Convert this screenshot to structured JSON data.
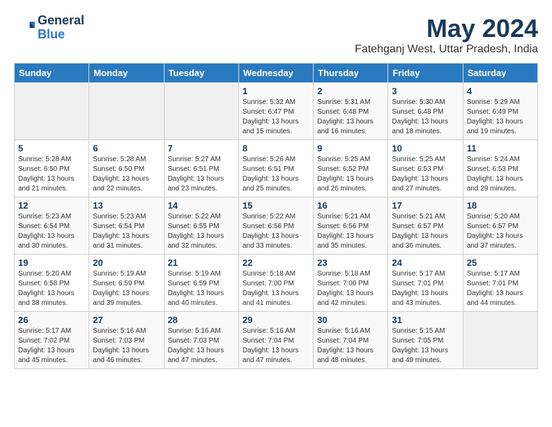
{
  "logo": {
    "line1": "General",
    "line2": "Blue"
  },
  "title": "May 2024",
  "subtitle": "Fatehganj West, Uttar Pradesh, India",
  "days_of_week": [
    "Sunday",
    "Monday",
    "Tuesday",
    "Wednesday",
    "Thursday",
    "Friday",
    "Saturday"
  ],
  "weeks": [
    [
      {
        "day": "",
        "info": ""
      },
      {
        "day": "",
        "info": ""
      },
      {
        "day": "",
        "info": ""
      },
      {
        "day": "1",
        "info": "Sunrise: 5:32 AM\nSunset: 6:47 PM\nDaylight: 13 hours\nand 15 minutes."
      },
      {
        "day": "2",
        "info": "Sunrise: 5:31 AM\nSunset: 6:48 PM\nDaylight: 13 hours\nand 16 minutes."
      },
      {
        "day": "3",
        "info": "Sunrise: 5:30 AM\nSunset: 6:48 PM\nDaylight: 13 hours\nand 18 minutes."
      },
      {
        "day": "4",
        "info": "Sunrise: 5:29 AM\nSunset: 6:49 PM\nDaylight: 13 hours\nand 19 minutes."
      }
    ],
    [
      {
        "day": "5",
        "info": "Sunrise: 5:28 AM\nSunset: 6:50 PM\nDaylight: 13 hours\nand 21 minutes."
      },
      {
        "day": "6",
        "info": "Sunrise: 5:28 AM\nSunset: 6:50 PM\nDaylight: 13 hours\nand 22 minutes."
      },
      {
        "day": "7",
        "info": "Sunrise: 5:27 AM\nSunset: 6:51 PM\nDaylight: 13 hours\nand 23 minutes."
      },
      {
        "day": "8",
        "info": "Sunrise: 5:26 AM\nSunset: 6:51 PM\nDaylight: 13 hours\nand 25 minutes."
      },
      {
        "day": "9",
        "info": "Sunrise: 5:25 AM\nSunset: 6:52 PM\nDaylight: 13 hours\nand 26 minutes."
      },
      {
        "day": "10",
        "info": "Sunrise: 5:25 AM\nSunset: 6:53 PM\nDaylight: 13 hours\nand 27 minutes."
      },
      {
        "day": "11",
        "info": "Sunrise: 5:24 AM\nSunset: 6:53 PM\nDaylight: 13 hours\nand 29 minutes."
      }
    ],
    [
      {
        "day": "12",
        "info": "Sunrise: 5:23 AM\nSunset: 6:54 PM\nDaylight: 13 hours\nand 30 minutes."
      },
      {
        "day": "13",
        "info": "Sunrise: 5:23 AM\nSunset: 6:54 PM\nDaylight: 13 hours\nand 31 minutes."
      },
      {
        "day": "14",
        "info": "Sunrise: 5:22 AM\nSunset: 6:55 PM\nDaylight: 13 hours\nand 32 minutes."
      },
      {
        "day": "15",
        "info": "Sunrise: 5:22 AM\nSunset: 6:56 PM\nDaylight: 13 hours\nand 33 minutes."
      },
      {
        "day": "16",
        "info": "Sunrise: 5:21 AM\nSunset: 6:56 PM\nDaylight: 13 hours\nand 35 minutes."
      },
      {
        "day": "17",
        "info": "Sunrise: 5:21 AM\nSunset: 6:57 PM\nDaylight: 13 hours\nand 36 minutes."
      },
      {
        "day": "18",
        "info": "Sunrise: 5:20 AM\nSunset: 6:57 PM\nDaylight: 13 hours\nand 37 minutes."
      }
    ],
    [
      {
        "day": "19",
        "info": "Sunrise: 5:20 AM\nSunset: 6:58 PM\nDaylight: 13 hours\nand 38 minutes."
      },
      {
        "day": "20",
        "info": "Sunrise: 5:19 AM\nSunset: 6:59 PM\nDaylight: 13 hours\nand 39 minutes."
      },
      {
        "day": "21",
        "info": "Sunrise: 5:19 AM\nSunset: 6:59 PM\nDaylight: 13 hours\nand 40 minutes."
      },
      {
        "day": "22",
        "info": "Sunrise: 5:18 AM\nSunset: 7:00 PM\nDaylight: 13 hours\nand 41 minutes."
      },
      {
        "day": "23",
        "info": "Sunrise: 5:18 AM\nSunset: 7:00 PM\nDaylight: 13 hours\nand 42 minutes."
      },
      {
        "day": "24",
        "info": "Sunrise: 5:17 AM\nSunset: 7:01 PM\nDaylight: 13 hours\nand 43 minutes."
      },
      {
        "day": "25",
        "info": "Sunrise: 5:17 AM\nSunset: 7:01 PM\nDaylight: 13 hours\nand 44 minutes."
      }
    ],
    [
      {
        "day": "26",
        "info": "Sunrise: 5:17 AM\nSunset: 7:02 PM\nDaylight: 13 hours\nand 45 minutes."
      },
      {
        "day": "27",
        "info": "Sunrise: 5:16 AM\nSunset: 7:03 PM\nDaylight: 13 hours\nand 46 minutes."
      },
      {
        "day": "28",
        "info": "Sunrise: 5:16 AM\nSunset: 7:03 PM\nDaylight: 13 hours\nand 47 minutes."
      },
      {
        "day": "29",
        "info": "Sunrise: 5:16 AM\nSunset: 7:04 PM\nDaylight: 13 hours\nand 47 minutes."
      },
      {
        "day": "30",
        "info": "Sunrise: 5:16 AM\nSunset: 7:04 PM\nDaylight: 13 hours\nand 48 minutes."
      },
      {
        "day": "31",
        "info": "Sunrise: 5:15 AM\nSunset: 7:05 PM\nDaylight: 13 hours\nand 49 minutes."
      },
      {
        "day": "",
        "info": ""
      }
    ]
  ]
}
